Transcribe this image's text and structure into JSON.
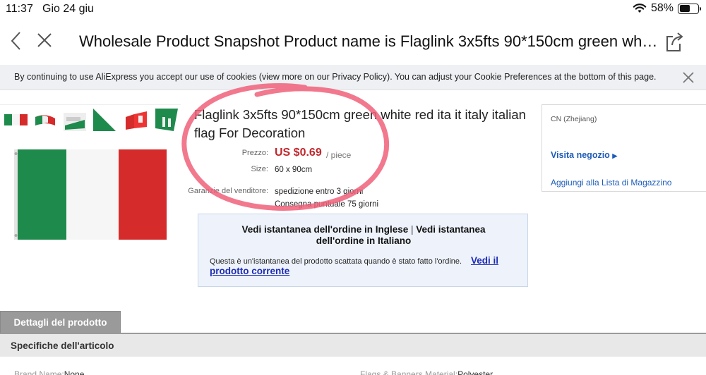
{
  "status_bar": {
    "time": "11:37",
    "date": "Gio 24 giu",
    "battery": "58%",
    "battery_level": 0.58
  },
  "nav": {
    "title": "Wholesale Product Snapshot Product name is Flaglink 3x5fts 90*150cm green whit..."
  },
  "cookie_banner": {
    "text": "By continuing to use AliExpress you accept our use of cookies (view more on our Privacy Policy). You can adjust your Cookie Preferences at the bottom of this page."
  },
  "product": {
    "title": "Flaglink 3x5fts 90*150cm green white red ita it italy italian flag For Decoration",
    "price_label": "Prezzo:",
    "price": "US $0.69",
    "price_unit": "/ piece",
    "size_label": "Size:",
    "size": "60 x 90cm",
    "guarantee_label": "Garanzie del venditore:",
    "guarantee_1": "spedizione entro 3 giorni",
    "guarantee_2": "Consegna puntuale 75 giorni"
  },
  "snapshot": {
    "english_link": "Vedi istantanea dell'ordine in Inglese",
    "separator": "|",
    "italian_link_1": "Vedi istantanea",
    "italian_link_2": "dell'ordine in Italiano",
    "note": "Questa è un'istantanea del prodotto scattata quando è stato fatto l'ordine.",
    "current_link_1": "Vedi il",
    "current_link_2": "prodotto corrente"
  },
  "seller": {
    "location": "CN (Zhejiang)",
    "visit_store": "Visita negozio",
    "add_wishlist": "Aggiungi alla Lista di Magazzino"
  },
  "tabs": {
    "details": "Dettagli del prodotto"
  },
  "specs": {
    "title": "Specifiche dell'articolo",
    "brand_label": "Brand Name:",
    "brand_value": "None",
    "material_label": "Flags & Banners Material:",
    "material_value": "Polyester"
  },
  "colors": {
    "price_red": "#c1272d",
    "link_blue": "#1d5db8",
    "flag_green": "#1e8a4c",
    "flag_red": "#d62b2b",
    "annotation": "#f0607a"
  }
}
